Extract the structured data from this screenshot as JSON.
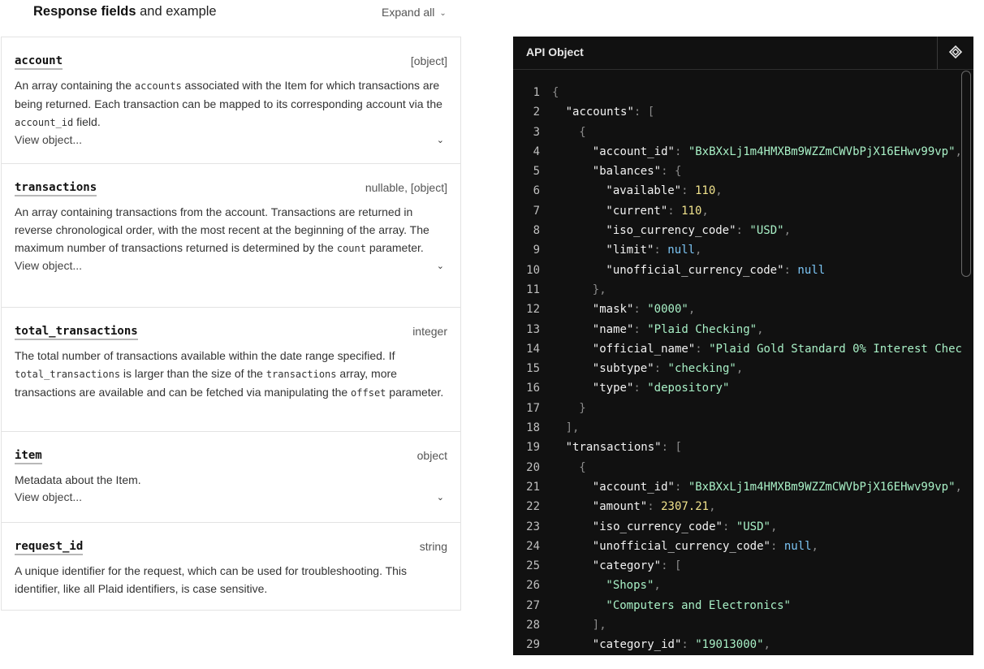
{
  "docs": {
    "title_bold": "Response fields",
    "title_rest": " and example",
    "expand_all": "Expand all",
    "view_object": "View object...",
    "fields": [
      {
        "name": "account",
        "type": "[object]",
        "desc_parts": [
          "An array containing the ",
          "accounts",
          " associated with the Item for which transactions are being returned. Each transaction can be mapped to its corresponding account via the ",
          "account_id",
          " field."
        ]
      },
      {
        "name": "transactions",
        "type": "nullable, [object]",
        "desc_parts": [
          "An array containing transactions from the account. Transactions are returned in reverse chronological order, with the most recent at the beginning of the array. The maximum number of transactions returned is determined by the ",
          "count",
          " parameter."
        ]
      },
      {
        "name": "total_transactions",
        "type": "integer",
        "desc_parts": [
          "The total number of transactions available within the date range specified. If ",
          "total_transactions",
          " is larger than the size of the ",
          "transactions",
          " array, more transactions are available and can be fetched via manipulating the ",
          "offset",
          " parameter."
        ]
      },
      {
        "name": "item",
        "type": "object",
        "desc_parts": [
          "Metadata about the Item."
        ]
      },
      {
        "name": "request_id",
        "type": "string",
        "desc_parts": [
          "A unique identifier for the request, which can be used for troubleshooting. This identifier, like all Plaid identifiers, is case sensitive."
        ]
      }
    ]
  },
  "code": {
    "title": "API Object",
    "toggle_icon": "expand-collapse-icon",
    "colors": {
      "background": "#111111",
      "string": "#a8f0c6",
      "number": "#f0e28c",
      "null": "#7cc6f6",
      "punct": "#8a8a8a"
    },
    "lines": [
      [
        [
          "p",
          "{"
        ]
      ],
      [
        [
          "k",
          "\"accounts\""
        ],
        [
          "p",
          ": ["
        ]
      ],
      [
        [
          "p",
          "{"
        ]
      ],
      [
        [
          "k",
          "\"account_id\""
        ],
        [
          "p",
          ": "
        ],
        [
          "s",
          "\"BxBXxLj1m4HMXBm9WZZmCWVbPjX16EHwv99vp\""
        ],
        [
          "p",
          ","
        ]
      ],
      [
        [
          "k",
          "\"balances\""
        ],
        [
          "p",
          ": {"
        ]
      ],
      [
        [
          "k",
          "\"available\""
        ],
        [
          "p",
          ": "
        ],
        [
          "n",
          "110"
        ],
        [
          "p",
          ","
        ]
      ],
      [
        [
          "k",
          "\"current\""
        ],
        [
          "p",
          ": "
        ],
        [
          "n",
          "110"
        ],
        [
          "p",
          ","
        ]
      ],
      [
        [
          "k",
          "\"iso_currency_code\""
        ],
        [
          "p",
          ": "
        ],
        [
          "s",
          "\"USD\""
        ],
        [
          "p",
          ","
        ]
      ],
      [
        [
          "k",
          "\"limit\""
        ],
        [
          "p",
          ": "
        ],
        [
          "nl",
          "null"
        ],
        [
          "p",
          ","
        ]
      ],
      [
        [
          "k",
          "\"unofficial_currency_code\""
        ],
        [
          "p",
          ": "
        ],
        [
          "nl",
          "null"
        ]
      ],
      [
        [
          "p",
          "},"
        ]
      ],
      [
        [
          "k",
          "\"mask\""
        ],
        [
          "p",
          ": "
        ],
        [
          "s",
          "\"0000\""
        ],
        [
          "p",
          ","
        ]
      ],
      [
        [
          "k",
          "\"name\""
        ],
        [
          "p",
          ": "
        ],
        [
          "s",
          "\"Plaid Checking\""
        ],
        [
          "p",
          ","
        ]
      ],
      [
        [
          "k",
          "\"official_name\""
        ],
        [
          "p",
          ": "
        ],
        [
          "s",
          "\"Plaid Gold Standard 0% Interest Chec"
        ]
      ],
      [
        [
          "k",
          "\"subtype\""
        ],
        [
          "p",
          ": "
        ],
        [
          "s",
          "\"checking\""
        ],
        [
          "p",
          ","
        ]
      ],
      [
        [
          "k",
          "\"type\""
        ],
        [
          "p",
          ": "
        ],
        [
          "s",
          "\"depository\""
        ]
      ],
      [
        [
          "p",
          "}"
        ]
      ],
      [
        [
          "p",
          "],"
        ]
      ],
      [
        [
          "k",
          "\"transactions\""
        ],
        [
          "p",
          ": ["
        ]
      ],
      [
        [
          "p",
          "{"
        ]
      ],
      [
        [
          "k",
          "\"account_id\""
        ],
        [
          "p",
          ": "
        ],
        [
          "s",
          "\"BxBXxLj1m4HMXBm9WZZmCWVbPjX16EHwv99vp\""
        ],
        [
          "p",
          ","
        ]
      ],
      [
        [
          "k",
          "\"amount\""
        ],
        [
          "p",
          ": "
        ],
        [
          "n",
          "2307.21"
        ],
        [
          "p",
          ","
        ]
      ],
      [
        [
          "k",
          "\"iso_currency_code\""
        ],
        [
          "p",
          ": "
        ],
        [
          "s",
          "\"USD\""
        ],
        [
          "p",
          ","
        ]
      ],
      [
        [
          "k",
          "\"unofficial_currency_code\""
        ],
        [
          "p",
          ": "
        ],
        [
          "nl",
          "null"
        ],
        [
          "p",
          ","
        ]
      ],
      [
        [
          "k",
          "\"category\""
        ],
        [
          "p",
          ": ["
        ]
      ],
      [
        [
          "s",
          "\"Shops\""
        ],
        [
          "p",
          ","
        ]
      ],
      [
        [
          "s",
          "\"Computers and Electronics\""
        ]
      ],
      [
        [
          "p",
          "],"
        ]
      ],
      [
        [
          "k",
          "\"category_id\""
        ],
        [
          "p",
          ": "
        ],
        [
          "s",
          "\"19013000\""
        ],
        [
          "p",
          ","
        ]
      ]
    ]
  }
}
